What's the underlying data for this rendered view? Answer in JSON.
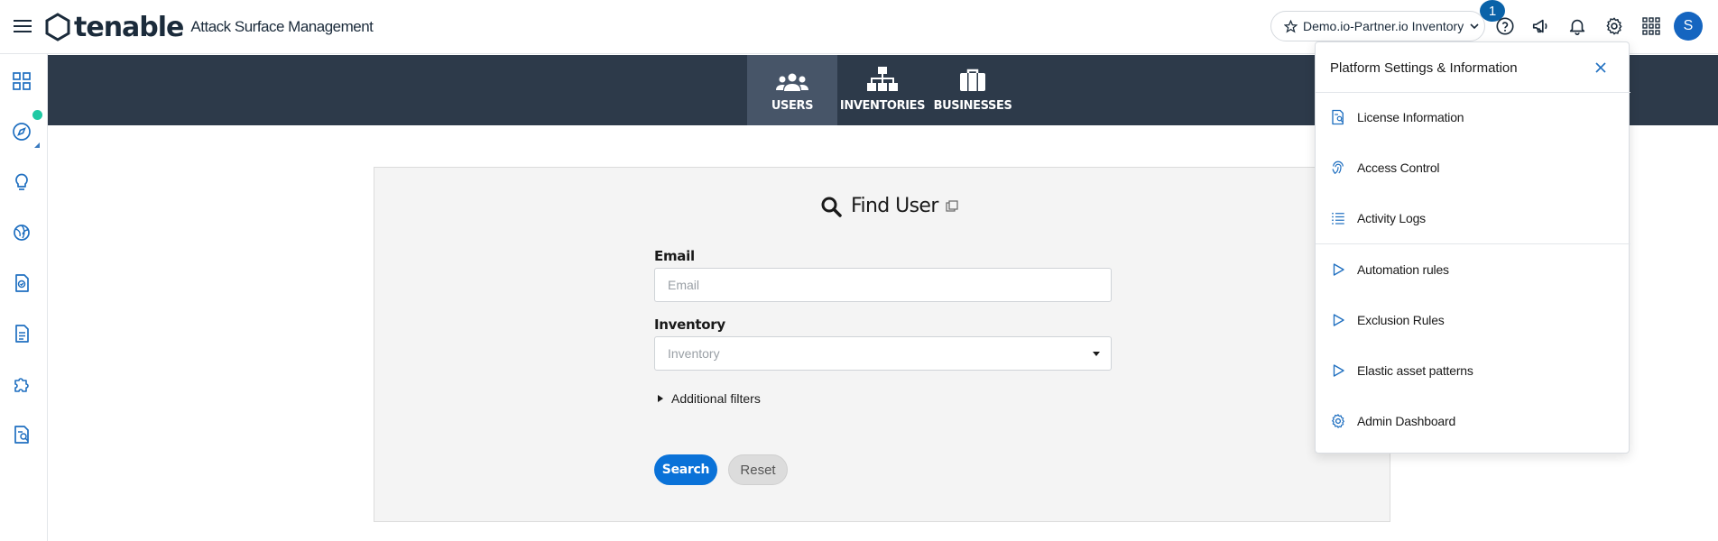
{
  "header": {
    "logo_mark": "tenable",
    "logo_sub": "Attack Surface Management",
    "inventory_label": "Demo.io-Partner.io Inventory",
    "notification_count": "1",
    "avatar_initial": "S"
  },
  "nav": {
    "tabs": [
      {
        "label": "USERS"
      },
      {
        "label": "INVENTORIES"
      },
      {
        "label": "BUSINESSES"
      }
    ]
  },
  "find_user": {
    "title": "Find User",
    "email_label": "Email",
    "email_placeholder": "Email",
    "email_value": "",
    "inventory_label": "Inventory",
    "inventory_placeholder": "Inventory",
    "additional_filters": "Additional filters",
    "search_label": "Search",
    "reset_label": "Reset"
  },
  "settings_menu": {
    "title": "Platform Settings & Information",
    "items": [
      {
        "label": "License Information",
        "icon": "license-icon"
      },
      {
        "label": "Access Control",
        "icon": "fingerprint-icon"
      },
      {
        "label": "Activity Logs",
        "icon": "list-icon"
      },
      {
        "label": "Automation rules",
        "icon": "play-outline-icon"
      },
      {
        "label": "Exclusion Rules",
        "icon": "play-outline-icon"
      },
      {
        "label": "Elastic asset patterns",
        "icon": "play-outline-icon"
      },
      {
        "label": "Admin Dashboard",
        "icon": "gear-icon"
      }
    ]
  },
  "colors": {
    "primary": "#0a72d8",
    "nav_band": "#2d3a4a",
    "nav_active": "#475568",
    "status_dot": "#1fc9a4"
  }
}
